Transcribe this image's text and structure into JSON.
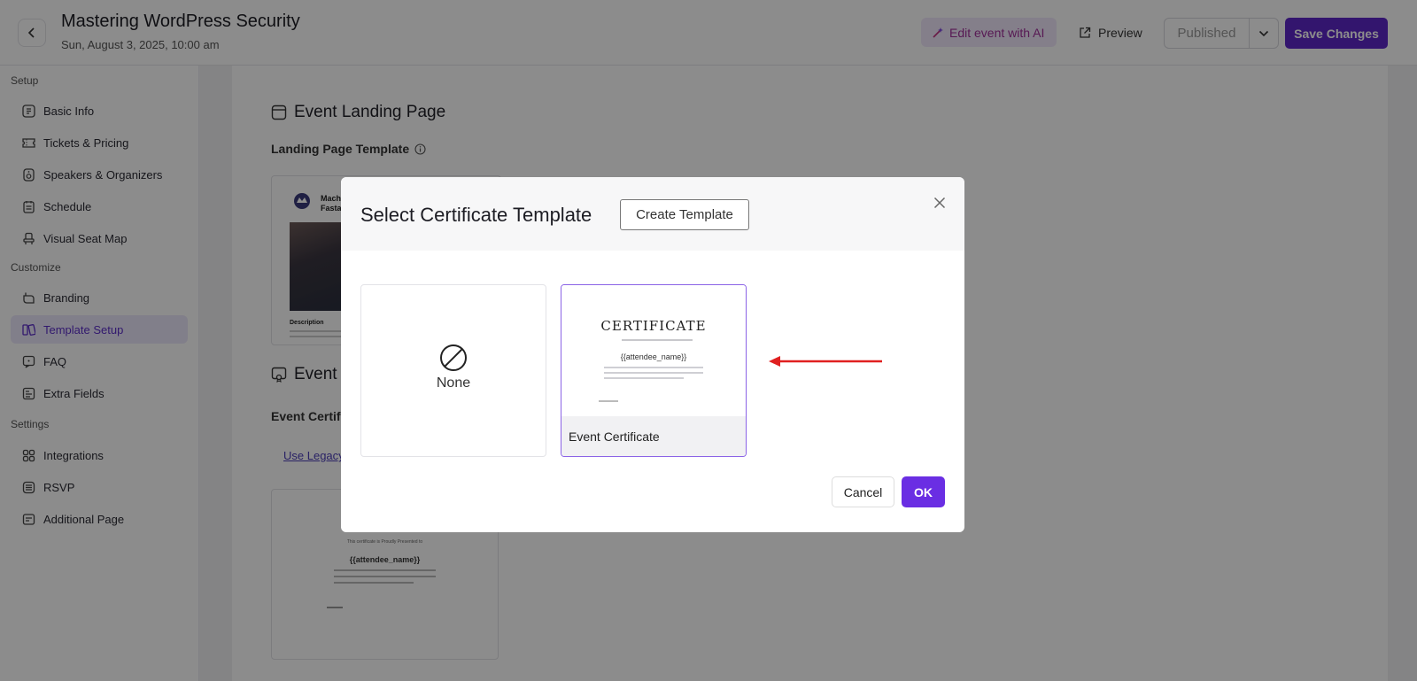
{
  "header": {
    "title": "Mastering WordPress Security",
    "date": "Sun, August 3, 2025, 10:00 am",
    "ai_label": "Edit event with AI",
    "preview_label": "Preview",
    "status_label": "Published",
    "save_label": "Save Changes"
  },
  "sidebar": {
    "sections": [
      {
        "title": "Setup"
      },
      {
        "title": "Customize"
      },
      {
        "title": "Settings"
      }
    ],
    "items": [
      {
        "label": "Basic Info",
        "icon": "info-grid-icon"
      },
      {
        "label": "Tickets & Pricing",
        "icon": "ticket-icon"
      },
      {
        "label": "Speakers & Organizers",
        "icon": "speaker-icon"
      },
      {
        "label": "Schedule",
        "icon": "schedule-icon"
      },
      {
        "label": "Visual Seat Map",
        "icon": "seat-icon"
      },
      {
        "label": "Branding",
        "icon": "branding-icon"
      },
      {
        "label": "Template Setup",
        "icon": "template-icon",
        "active": true
      },
      {
        "label": "FAQ",
        "icon": "faq-icon"
      },
      {
        "label": "Extra Fields",
        "icon": "fields-icon"
      },
      {
        "label": "Integrations",
        "icon": "integrations-icon"
      },
      {
        "label": "RSVP",
        "icon": "rsvp-icon"
      },
      {
        "label": "Additional Page",
        "icon": "page-icon"
      }
    ]
  },
  "main": {
    "landing_title": "Event Landing Page",
    "landing_template_label": "Landing Page Template",
    "cert_section_title": "Event C",
    "cert_field_label": "Event Certifi",
    "legacy_link": "Use Legacy",
    "landing_thumb": {
      "title_line1": "Machi",
      "title_line2": "Fastai",
      "description": "Description"
    },
    "cert_thumb": {
      "presented": "This certificate is Proudly Presented to",
      "name": "{{attendee_name}}"
    }
  },
  "modal": {
    "title": "Select Certificate Template",
    "create_label": "Create Template",
    "none_label": "None",
    "template_name": "Event Certificate",
    "cert_heading": "CERTIFICATE",
    "cert_name": "{{attendee_name}}",
    "cancel_label": "Cancel",
    "ok_label": "OK"
  },
  "colors": {
    "accent": "#5e27c8",
    "ok": "#6a2ee3",
    "arrow": "#e02020",
    "active_bg": "#ece7fb"
  }
}
